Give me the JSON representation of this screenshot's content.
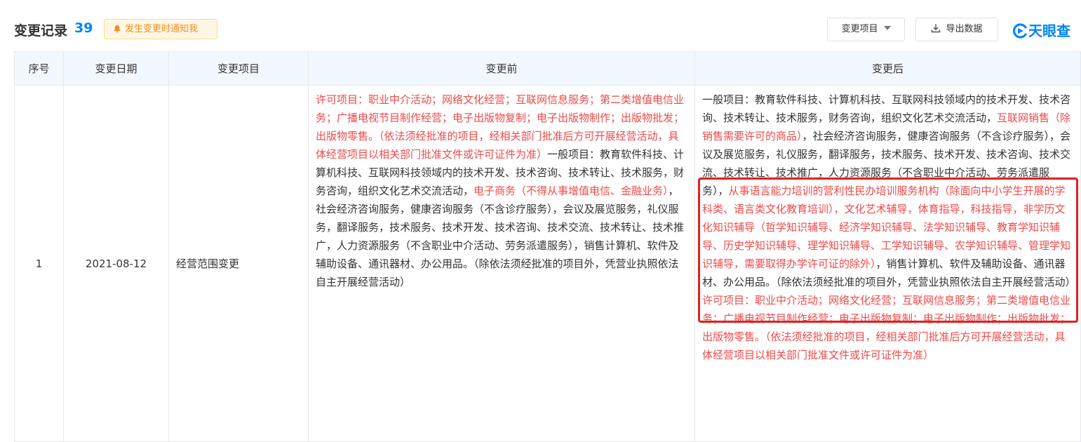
{
  "header": {
    "title": "变更记录",
    "count": "39",
    "notify_label": "发生变更时通知我",
    "filter_label": "变更项目",
    "export_label": "导出数据",
    "brand_name": "天眼查"
  },
  "table": {
    "columns": [
      "序号",
      "变更日期",
      "变更项目",
      "变更前",
      "变更后"
    ],
    "rows": [
      {
        "index": "1",
        "date": "2021-08-12",
        "item": "经营范围变更",
        "before": [
          {
            "text": "许可项目：职业中介活动；网络文化经营；互联网信息服务；第二类增值电信业务；广播电视节目制作经营；电子出版物复制；电子出版物制作；出版物批发；出版物零售。（依法须经批准的项目，经相关部门批准后方可开展经营活动，具体经营项目以相关部门批准文件或许可证件为准）",
            "red": true
          },
          {
            "text": "一般项目：教育软件科技、计算机科技、互联网科技领域内的技术开发、技术咨询、技术转让、技术服务，财务咨询，组织文化艺术交流活动，",
            "red": false
          },
          {
            "text": "电子商务（不得从事增值电信、金融业务）",
            "red": true
          },
          {
            "text": "，社会经济咨询服务，健康咨询服务（不含诊疗服务），会议及展览服务，礼仪服务，翻译服务，技术服务、技术开发、技术咨询、技术交流、技术转让、技术推广，人力资源服务（不含职业中介活动、劳务派遣服务），销售计算机、软件及辅助设备、通讯器材、办公用品。（除依法须经批准的项目外，凭营业执照依法自主开展经营活动）",
            "red": false
          }
        ],
        "after": [
          {
            "text": "一般项目：教育软件科技、计算机科技、互联网科技领域内的技术开发、技术咨询、技术转让、技术服务，财务咨询，组织文化艺术交流活动，",
            "red": false
          },
          {
            "text": "互联网销售（除销售需要许可的商品）",
            "red": true
          },
          {
            "text": "，社会经济咨询服务，健康咨询服务（不含诊疗服务），会议及展览服务，礼仪服务，翻译服务，技术服务、技术开发、技术咨询、技术交流、技术转让、技术推广，人力资源服务（不含职业中介活动、劳务派遣服务），",
            "red": false
          },
          {
            "text": "从事语言能力培训的营利性民办培训服务机构（除面向中小学生开展的学科类、语言类文化教育培训），文化艺术辅导，体育指导，科技指导，非学历文化知识辅导（哲学知识辅导、经济学知识辅导、法学知识辅导、教育学知识辅导、历史学知识辅导、理学知识辅导、工学知识辅导、农学知识辅导、管理学知识辅导，需要取得办学许可证的除外）",
            "red": true
          },
          {
            "text": "，销售计算机、软件及辅助设备、通讯器材、办公用品。（除依法须经批准的项目外，凭营业执照依法自主开展经营活动）",
            "red": false
          },
          {
            "text": "许可项目：职业中介活动；网络文化经营；互联网信息服务；第二类增值电信业务；广播电视节目制作经营；电子出版物复制；电子出版物制作；出版物批发；出版物零售。（依法须经批准的项目，经相关部门批准后方可开展经营活动，具体经营项目以相关部门批准文件或许可证件为准）",
            "red": true
          }
        ]
      }
    ]
  },
  "colors": {
    "accent": "#0084ff",
    "changed_text": "#ef4a4a",
    "notify_text": "#fa8c16",
    "header_bg": "#f2f8ff",
    "highlight": "#e02020"
  },
  "icons": {
    "notify": "bell-icon",
    "filter": "caret-down-icon",
    "export": "download-icon",
    "brand": "tianyancha-logo-icon"
  }
}
